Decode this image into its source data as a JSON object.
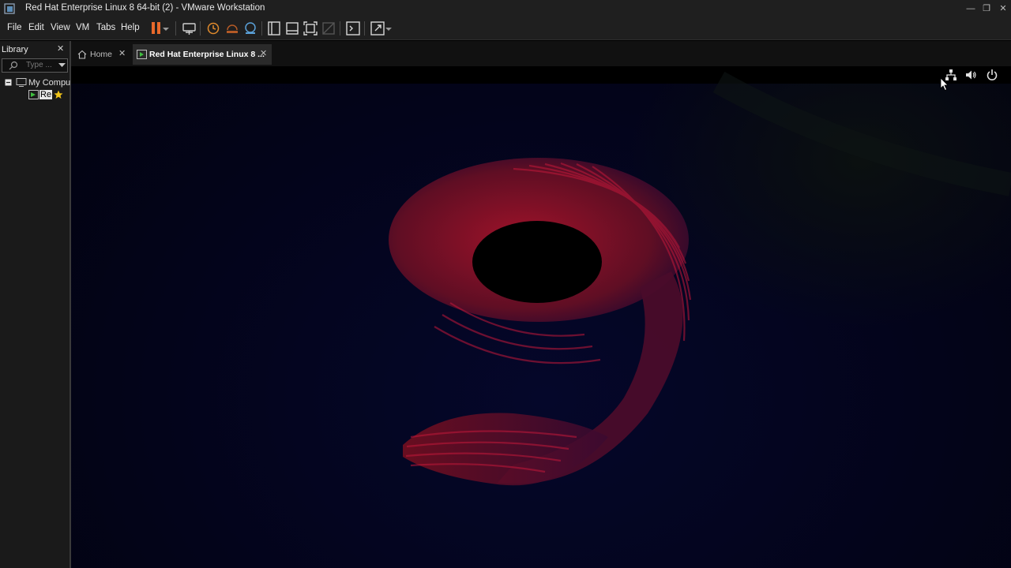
{
  "window": {
    "title": "Red Hat Enterprise Linux 8 64-bit (2) - VMware Workstation",
    "controls": [
      "minimize",
      "restore",
      "close"
    ]
  },
  "menubar": {
    "items": [
      "File",
      "Edit",
      "View",
      "VM",
      "Tabs",
      "Help"
    ]
  },
  "toolbar": {
    "icons": [
      "pause-icon",
      "send-keys-icon",
      "snapshot-icon",
      "revert-snapshot-icon",
      "snapshot-manager-icon",
      "library-view-icon",
      "thumbnail-view-icon",
      "full-screen-icon",
      "unity-icon",
      "console-icon",
      "stretch-icon"
    ]
  },
  "library": {
    "header": "Library",
    "search_placeholder": "Type ...",
    "tree": {
      "root_label": "My Compu",
      "vm_label": "Re"
    }
  },
  "tabs": [
    {
      "label": "Home",
      "active": false
    },
    {
      "label": "Red Hat Enterprise Linux 8 ...",
      "active": true
    }
  ],
  "guest": {
    "status_icons": [
      "network-icon",
      "volume-icon",
      "power-icon"
    ],
    "wallpaper": "9",
    "colors": {
      "accent_red": "#9c0f1c",
      "background": "#03041a"
    }
  }
}
